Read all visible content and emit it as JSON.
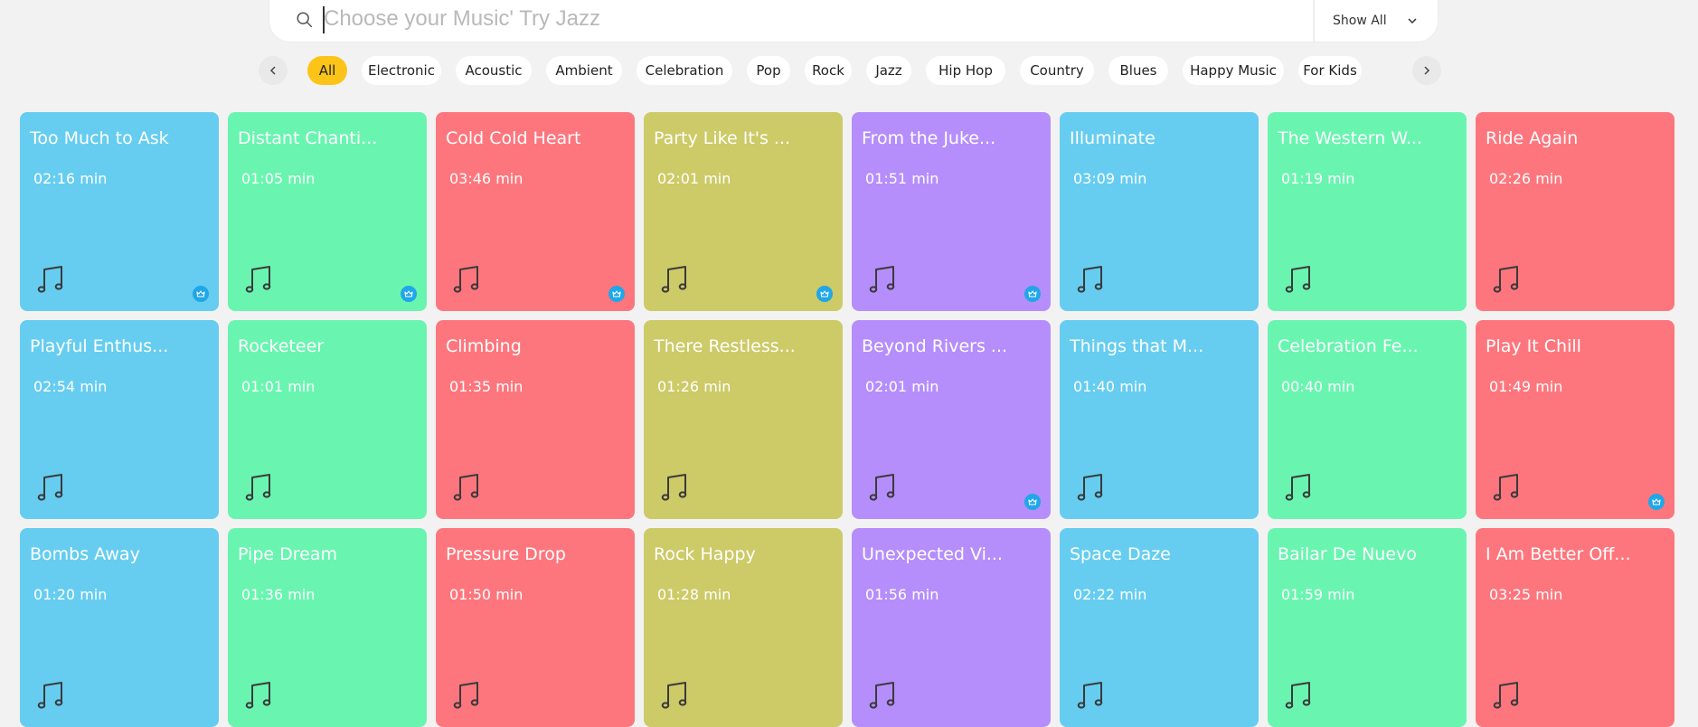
{
  "search": {
    "placeholder": "Choose your Music' Try Jazz",
    "icon": "search-icon"
  },
  "filter": {
    "label": "Show All",
    "icon": "chevron-down-icon"
  },
  "categories": [
    {
      "label": "All",
      "active": true
    },
    {
      "label": "Electronic",
      "active": false
    },
    {
      "label": "Acoustic",
      "active": false
    },
    {
      "label": "Ambient",
      "active": false
    },
    {
      "label": "Celebration",
      "active": false
    },
    {
      "label": "Pop",
      "active": false
    },
    {
      "label": "Rock",
      "active": false
    },
    {
      "label": "Jazz",
      "active": false
    },
    {
      "label": "Hip Hop",
      "active": false
    },
    {
      "label": "Country",
      "active": false
    },
    {
      "label": "Blues",
      "active": false
    },
    {
      "label": "Happy Music",
      "active": false
    },
    {
      "label": "For Kids",
      "active": false
    }
  ],
  "colors": {
    "blue": "#66cdf0",
    "green": "#69f5b0",
    "red": "#fe767d",
    "olive": "#cdca68",
    "purple": "#b58efc",
    "accent": "#fcc419",
    "premium": "#1fa7e8"
  },
  "tracks": [
    {
      "title": "Too Much to Ask",
      "duration": "02:16 min",
      "color": "blue",
      "premium": true
    },
    {
      "title": "Distant Chanti...",
      "duration": "01:05 min",
      "color": "green",
      "premium": true
    },
    {
      "title": "Cold Cold Heart",
      "duration": "03:46 min",
      "color": "red",
      "premium": true
    },
    {
      "title": "Party Like It's ...",
      "duration": "02:01 min",
      "color": "olive",
      "premium": true
    },
    {
      "title": "From the Juke...",
      "duration": "01:51 min",
      "color": "purple",
      "premium": true
    },
    {
      "title": "Illuminate",
      "duration": "03:09 min",
      "color": "blue",
      "premium": false
    },
    {
      "title": "The Western W...",
      "duration": "01:19 min",
      "color": "green",
      "premium": false
    },
    {
      "title": "Ride Again",
      "duration": "02:26 min",
      "color": "red",
      "premium": false
    },
    {
      "title": "Playful Enthus...",
      "duration": "02:54 min",
      "color": "blue",
      "premium": false
    },
    {
      "title": "Rocketeer",
      "duration": "01:01 min",
      "color": "green",
      "premium": false
    },
    {
      "title": "Climbing",
      "duration": "01:35 min",
      "color": "red",
      "premium": false
    },
    {
      "title": "There Restless...",
      "duration": "01:26 min",
      "color": "olive",
      "premium": false
    },
    {
      "title": "Beyond Rivers ...",
      "duration": "02:01 min",
      "color": "purple",
      "premium": true
    },
    {
      "title": "Things that M...",
      "duration": "01:40 min",
      "color": "blue",
      "premium": false
    },
    {
      "title": "Celebration Fe...",
      "duration": "00:40 min",
      "color": "green",
      "premium": false
    },
    {
      "title": "Play It Chill",
      "duration": "01:49 min",
      "color": "red",
      "premium": true
    },
    {
      "title": "Bombs Away",
      "duration": "01:20 min",
      "color": "blue",
      "premium": false
    },
    {
      "title": "Pipe Dream",
      "duration": "01:36 min",
      "color": "green",
      "premium": false
    },
    {
      "title": "Pressure Drop",
      "duration": "01:50 min",
      "color": "red",
      "premium": false
    },
    {
      "title": "Rock Happy",
      "duration": "01:28 min",
      "color": "olive",
      "premium": false
    },
    {
      "title": "Unexpected Vi...",
      "duration": "01:56 min",
      "color": "purple",
      "premium": false
    },
    {
      "title": "Space Daze",
      "duration": "02:22 min",
      "color": "blue",
      "premium": false
    },
    {
      "title": "Bailar De Nuevo",
      "duration": "01:59 min",
      "color": "green",
      "premium": false
    },
    {
      "title": "I Am Better Off...",
      "duration": "03:25 min",
      "color": "red",
      "premium": false
    }
  ]
}
